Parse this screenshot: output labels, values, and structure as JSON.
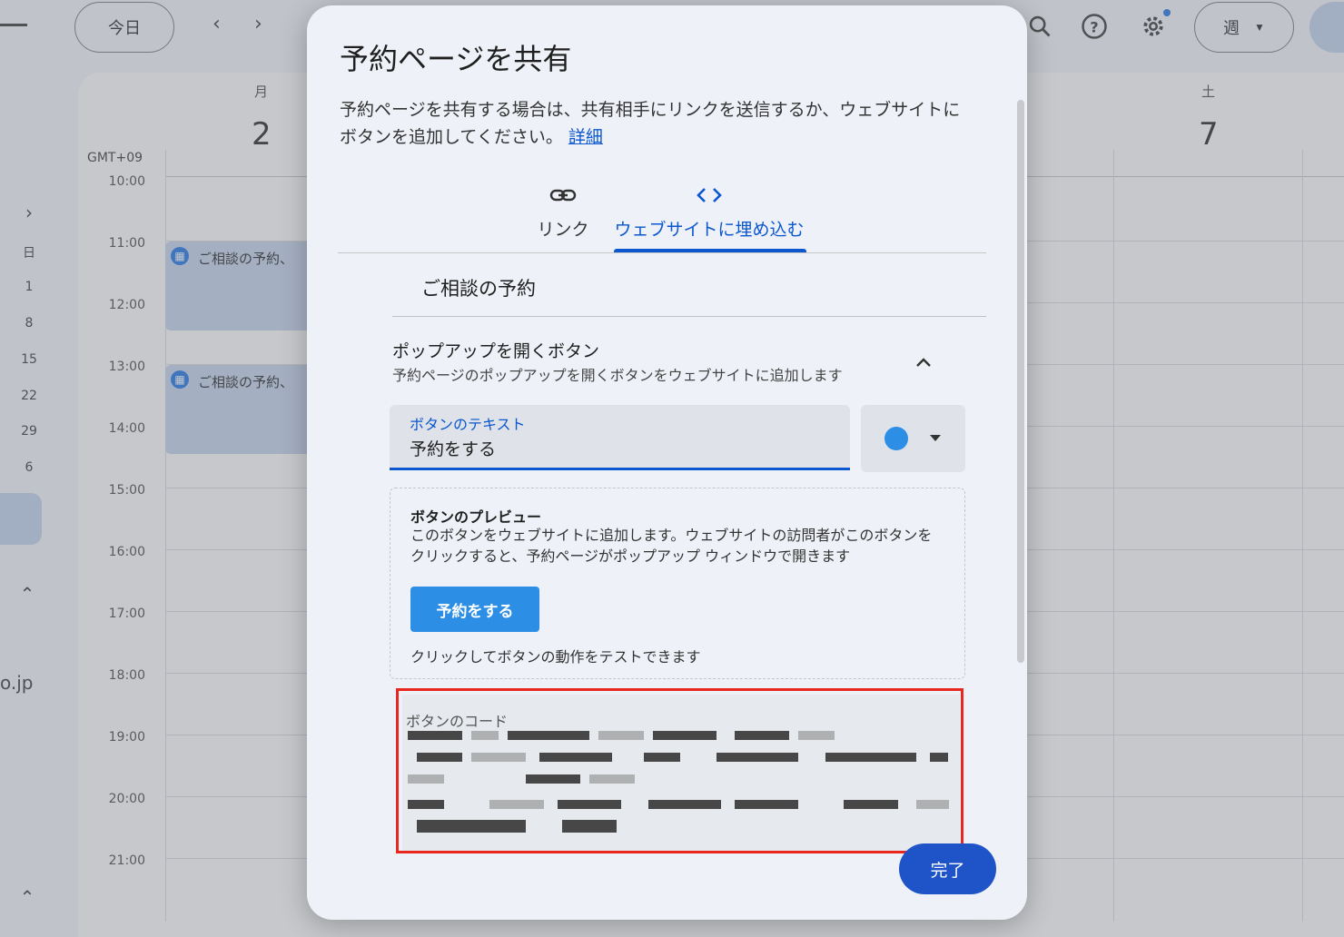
{
  "header": {
    "today_label": "今日",
    "week_label": "週"
  },
  "calendar": {
    "days": [
      {
        "name": "月",
        "number": "2"
      },
      {
        "name": "土",
        "number": "7"
      }
    ],
    "timezone": "GMT+09",
    "hours": [
      "10:00",
      "11:00",
      "12:00",
      "13:00",
      "14:00",
      "15:00",
      "16:00",
      "17:00",
      "18:00",
      "19:00",
      "20:00",
      "21:00"
    ],
    "events": [
      "ご相談の予約、",
      "ご相談の予約、"
    ],
    "sidebar": {
      "mini_labels": [
        "日",
        "1",
        "8",
        "15",
        "22",
        "29",
        "6"
      ],
      "email_fragment": "o.jp"
    }
  },
  "dialog": {
    "title": "予約ページを共有",
    "description": "予約ページを共有する場合は、共有相手にリンクを送信するか、ウェブサイトにボタンを追加してください。",
    "learn_more": "詳細",
    "tabs": [
      {
        "label": "リンク",
        "icon": "link-icon"
      },
      {
        "label": "ウェブサイトに埋め込む",
        "icon": "code-icon"
      }
    ],
    "page_name": "ご相談の予約",
    "section": {
      "title": "ポップアップを開くボタン",
      "subtitle": "予約ページのポップアップを開くボタンをウェブサイトに追加します"
    },
    "text_field": {
      "label": "ボタンのテキスト",
      "value": "予約をする"
    },
    "color": "#2d8ee6",
    "preview": {
      "title": "ボタンのプレビュー",
      "description": "このボタンをウェブサイトに追加します。ウェブサイトの訪問者がこのボタンをクリックすると、予約ページがポップアップ ウィンドウで開きます",
      "button_label": "予約をする",
      "hint": "クリックしてボタンの動作をテストできます"
    },
    "code": {
      "label": "ボタンのコード"
    },
    "done_label": "完了"
  },
  "colors": {
    "accent": "#0b57d0",
    "highlight_border": "#e8281e",
    "done_button": "#1f54c9"
  }
}
